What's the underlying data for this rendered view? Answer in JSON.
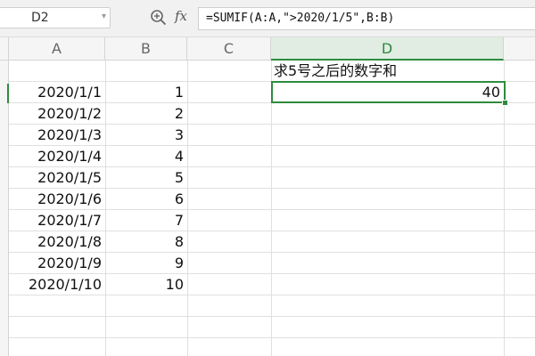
{
  "formula_bar": {
    "name_box": "D2",
    "fx_label": "fx",
    "formula": "=SUMIF(A:A,\">2020/1/5\",B:B)"
  },
  "columns": [
    "A",
    "B",
    "C",
    "D"
  ],
  "rows": [
    {
      "a": "2020/1/1",
      "b": "1"
    },
    {
      "a": "2020/1/2",
      "b": "2"
    },
    {
      "a": "2020/1/3",
      "b": "3"
    },
    {
      "a": "2020/1/4",
      "b": "4"
    },
    {
      "a": "2020/1/5",
      "b": "5"
    },
    {
      "a": "2020/1/6",
      "b": "6"
    },
    {
      "a": "2020/1/7",
      "b": "7"
    },
    {
      "a": "2020/1/8",
      "b": "8"
    },
    {
      "a": "2020/1/9",
      "b": "9"
    },
    {
      "a": "2020/1/10",
      "b": "10"
    }
  ],
  "d1": "求5号之后的数字和",
  "d2": "40",
  "colors": {
    "accent": "#2e8b3e",
    "header_bg": "#f5f5f5",
    "grid_line": "#e0e0e0"
  },
  "icons": {
    "zoom": "zoom-icon",
    "dropdown": "chevron-down-icon"
  }
}
